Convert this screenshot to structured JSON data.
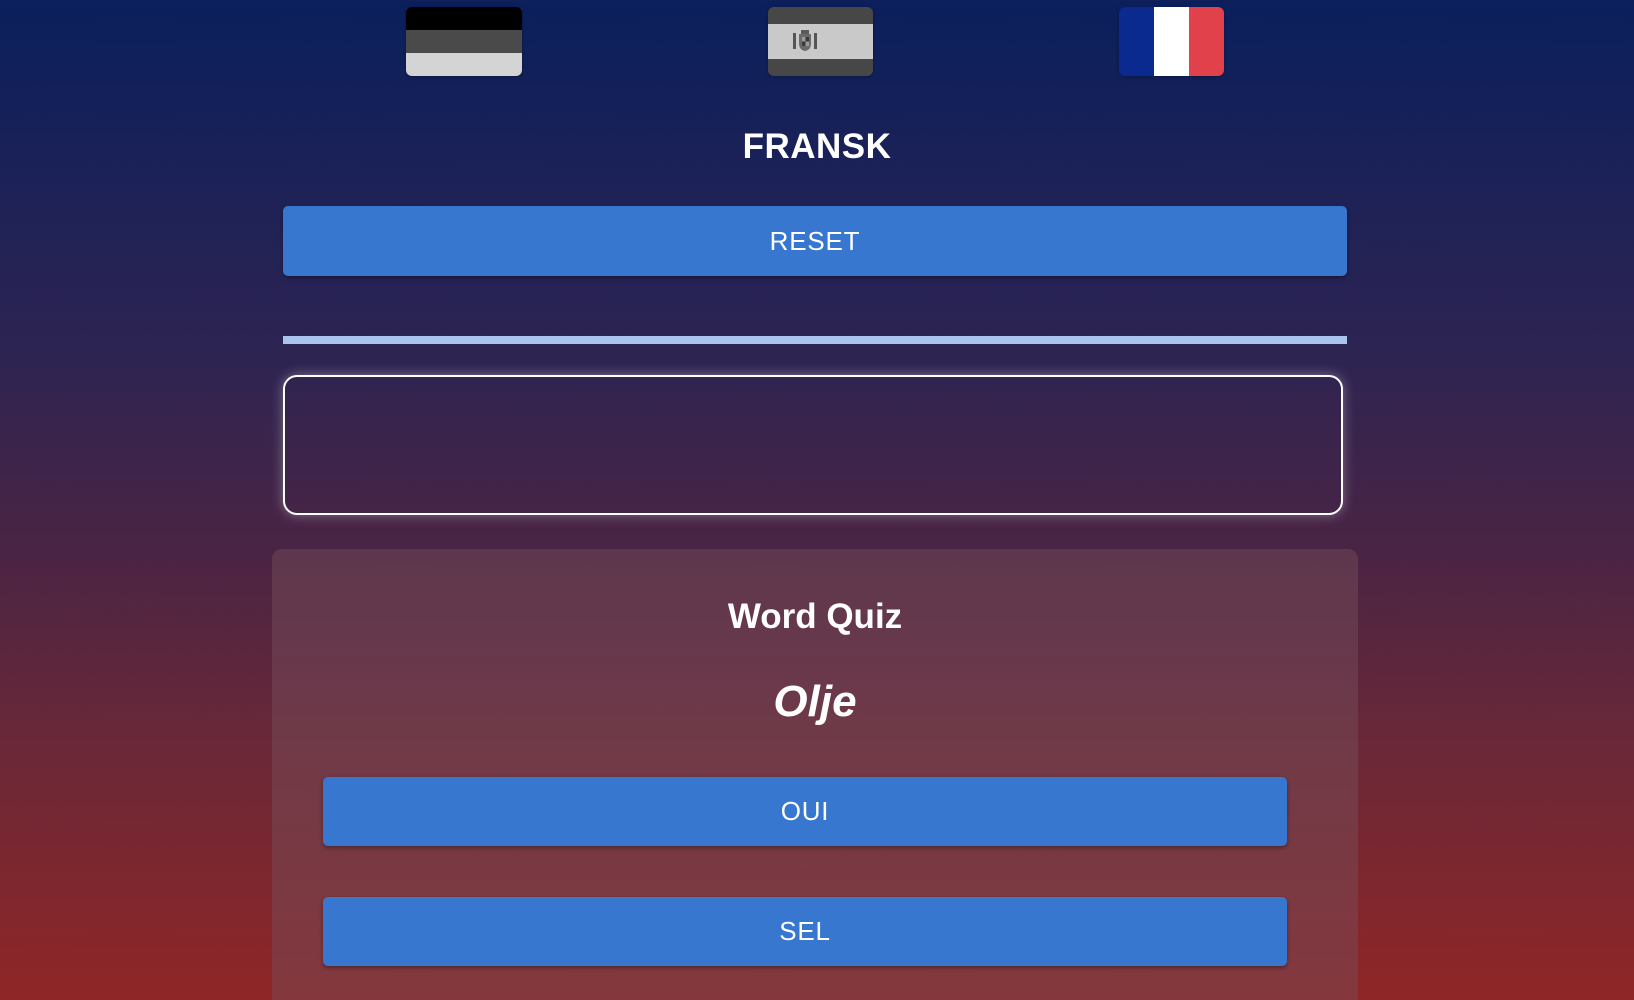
{
  "flags": [
    {
      "name": "german",
      "colors": [
        "#000000",
        "#4a4a4a",
        "#d4d4d4"
      ],
      "grayscale": true
    },
    {
      "name": "spanish",
      "colors": [
        "#474747",
        "#c9c9c9",
        "#474747"
      ],
      "grayscale": true
    },
    {
      "name": "french",
      "colors": [
        "#0a2a8f",
        "#ffffff",
        "#e0414a"
      ],
      "grayscale": false
    }
  ],
  "header": {
    "title": "FRANSK"
  },
  "controls": {
    "reset_label": "RESET"
  },
  "progress": {
    "fraction": 1.0
  },
  "answer": {
    "value": ""
  },
  "quiz": {
    "heading": "Word Quiz",
    "word": "Olje",
    "options": [
      "OUI",
      "SEL"
    ]
  },
  "colors": {
    "accent": "#3777cf",
    "progress": "#a9c5ee"
  }
}
